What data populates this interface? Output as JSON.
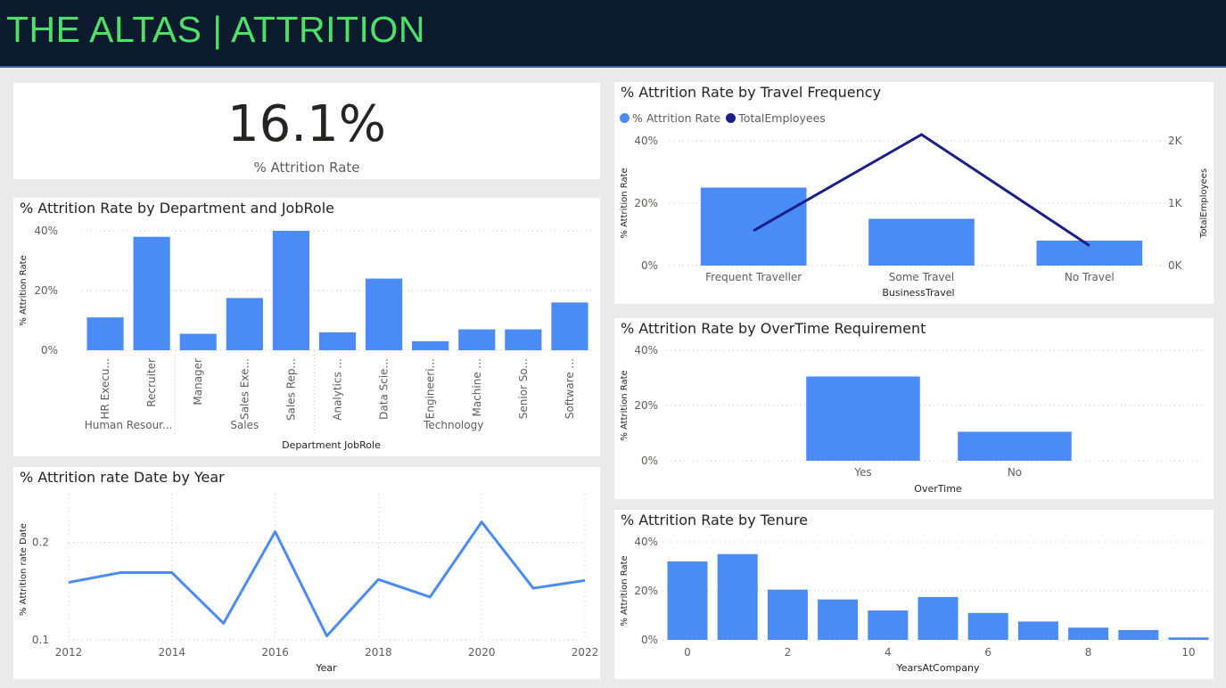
{
  "header": {
    "title": "THE ALTAS | ATTRITION"
  },
  "kpi": {
    "value": "16.1%",
    "label": "% Attrition Rate"
  },
  "colors": {
    "bar": "#4a8bf5",
    "line_dark": "#1b1f8a",
    "header_bg": "#0b1a2c",
    "title_green": "#4ee06a"
  },
  "chart_data": [
    {
      "id": "dept",
      "type": "bar",
      "title": "% Attrition Rate by Department and JobRole",
      "xlabel": "Department JobRole",
      "ylabel": "% Attrition Rate",
      "ylim": [
        0,
        40
      ],
      "yticks": [
        "0%",
        "20%",
        "40%"
      ],
      "groups": [
        {
          "name": "Human Resour...",
          "categories": [
            "HR Execu...",
            "Recruiter"
          ],
          "values": [
            11,
            38
          ]
        },
        {
          "name": "Sales",
          "categories": [
            "Manager",
            "Sales Exe...",
            "Sales Rep..."
          ],
          "values": [
            5.5,
            17.5,
            40
          ]
        },
        {
          "name": "Technology",
          "categories": [
            "Analytics ...",
            "Data Scie...",
            "Engineeri...",
            "Machine ...",
            "Senior So...",
            "Software ..."
          ],
          "values": [
            6,
            24,
            3,
            7,
            7,
            16
          ]
        }
      ]
    },
    {
      "id": "year",
      "type": "line",
      "title": "% Attrition rate Date by Year",
      "xlabel": "Year",
      "ylabel": "% Attrition rate Date",
      "xlim": [
        2012,
        2022
      ],
      "ylim": [
        0.1,
        0.25
      ],
      "xticks": [
        "2012",
        "2014",
        "2016",
        "2018",
        "2020",
        "2022"
      ],
      "yticks": [
        "0.1",
        "0.2"
      ],
      "x": [
        2012,
        2013,
        2014,
        2015,
        2016,
        2017,
        2018,
        2019,
        2020,
        2021,
        2022
      ],
      "values": [
        0.159,
        0.169,
        0.169,
        0.117,
        0.211,
        0.104,
        0.162,
        0.144,
        0.221,
        0.153,
        0.161
      ]
    },
    {
      "id": "travel",
      "type": "bar",
      "title": "% Attrition Rate by Travel Frequency",
      "xlabel": "BusinessTravel",
      "ylabel": "% Attrition Rate",
      "y2label": "TotalEmployees",
      "legend": [
        "% Attrition Rate",
        "TotalEmployees"
      ],
      "legend_position": "top-left",
      "categories": [
        "Frequent Traveller",
        "Some Travel",
        "No Travel"
      ],
      "series": [
        {
          "name": "% Attrition Rate",
          "values": [
            25,
            15,
            8
          ],
          "axis": "left"
        },
        {
          "name": "TotalEmployees",
          "values": [
            560,
            2100,
            320
          ],
          "axis": "right",
          "kind": "line"
        }
      ],
      "ylim": [
        0,
        40
      ],
      "y2lim": [
        0,
        2000
      ],
      "yticks": [
        "0%",
        "20%",
        "40%"
      ],
      "y2ticks": [
        "0K",
        "1K",
        "2K"
      ]
    },
    {
      "id": "overtime",
      "type": "bar",
      "title": "% Attrition Rate by OverTime Requirement",
      "xlabel": "OverTime",
      "ylabel": "% Attrition Rate",
      "ylim": [
        0,
        40
      ],
      "yticks": [
        "0%",
        "20%",
        "40%"
      ],
      "categories": [
        "Yes",
        "No"
      ],
      "values": [
        30.5,
        10.5
      ]
    },
    {
      "id": "tenure",
      "type": "bar",
      "title": "% Attrition Rate by Tenure",
      "xlabel": "YearsAtCompany",
      "ylabel": "% Attrition Rate",
      "ylim": [
        0,
        40
      ],
      "yticks": [
        "0%",
        "20%",
        "40%"
      ],
      "xticks": [
        "0",
        "2",
        "4",
        "6",
        "8",
        "10"
      ],
      "x": [
        0,
        1,
        2,
        3,
        4,
        5,
        6,
        7,
        8,
        9,
        10
      ],
      "values": [
        32,
        35,
        20.5,
        16.5,
        12,
        17.5,
        11,
        7.5,
        5,
        4,
        1
      ]
    }
  ]
}
